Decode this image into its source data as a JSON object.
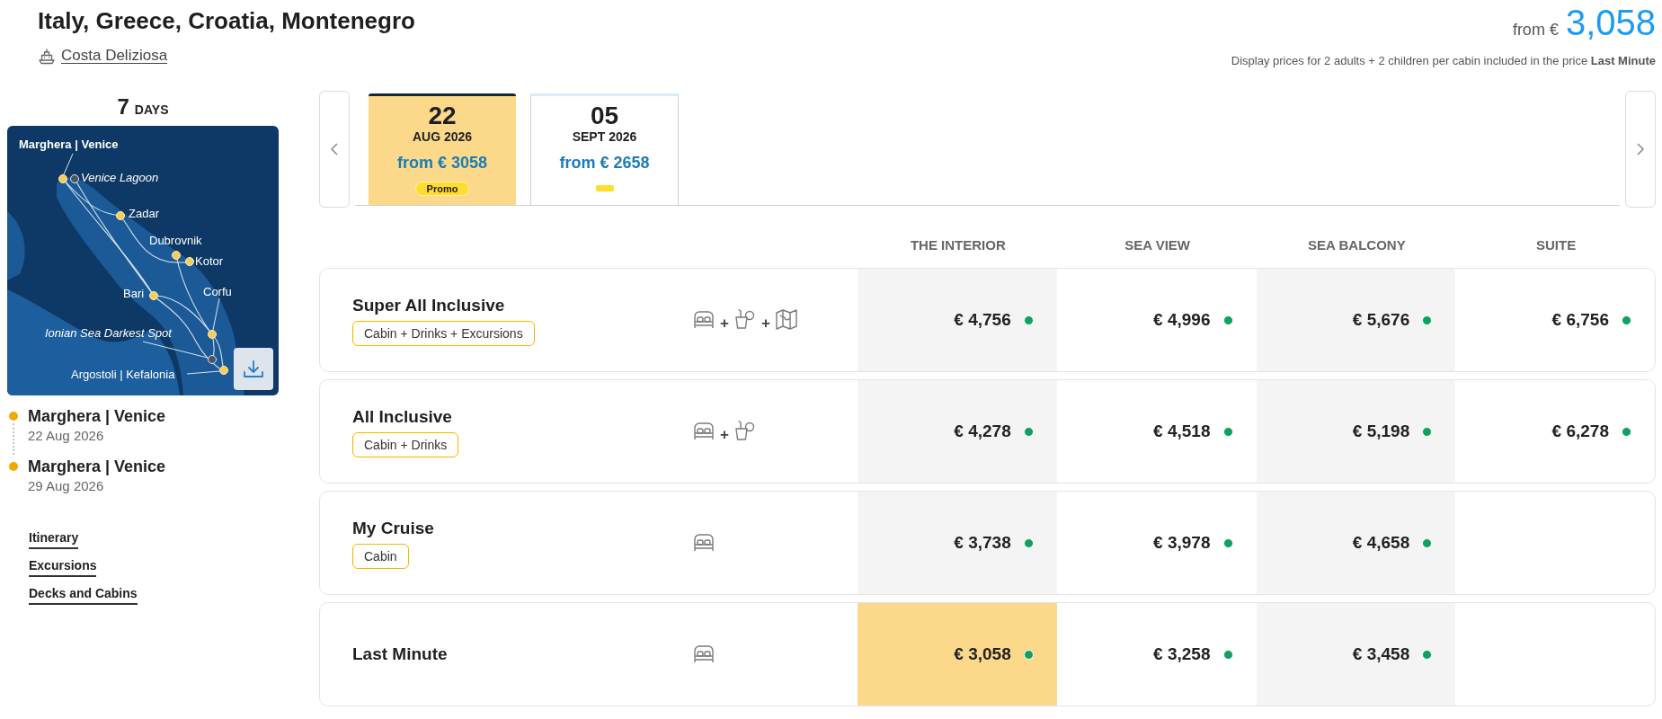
{
  "header": {
    "title": "Italy, Greece, Croatia, Montenegro",
    "ship": "Costa Deliziosa",
    "price_prefix": "from €",
    "price": "3,058",
    "note": "Display prices for 2 adults + 2 children per cabin included in the price **Last Minute**"
  },
  "sidebar": {
    "duration_number": "7",
    "duration_unit": "DAYS",
    "map_labels": [
      {
        "text": "Marghera | Venice",
        "kind": "home"
      },
      {
        "text": "Venice Lagoon",
        "kind": "scenic"
      },
      {
        "text": "Zadar",
        "kind": "port"
      },
      {
        "text": "Dubrovnik",
        "kind": "port"
      },
      {
        "text": "Kotor",
        "kind": "port"
      },
      {
        "text": "Bari",
        "kind": "port"
      },
      {
        "text": "Corfu",
        "kind": "port"
      },
      {
        "text": "Ionian Sea Darkest Spot",
        "kind": "scenic"
      },
      {
        "text": "Argostoli | Kefalonia",
        "kind": "port"
      }
    ],
    "ports": [
      {
        "name": "Marghera | Venice",
        "date": "22 Aug 2026"
      },
      {
        "name": "Marghera | Venice",
        "date": "29 Aug 2026"
      }
    ],
    "links": [
      "Itinerary",
      "Excursions",
      "Decks and Cabins"
    ]
  },
  "date_tabs": [
    {
      "day": "22",
      "month": "AUG 2026",
      "price": "from € 3058",
      "badge": "Promo",
      "selected": true
    },
    {
      "day": "05",
      "month": "SEPT 2026",
      "price": "from € 2658",
      "selected": false
    }
  ],
  "fare_table": {
    "columns": [
      "THE INTERIOR",
      "SEA VIEW",
      "SEA BALCONY",
      "SUITE"
    ],
    "rows": [
      {
        "name": "Super All Inclusive",
        "tag": "Cabin + Drinks + Excursions",
        "services": [
          {
            "kind": "cabin"
          },
          {
            "kind": "drinks",
            "joiner": "+"
          },
          {
            "kind": "excursions",
            "joiner": "+"
          }
        ],
        "prices": [
          {
            "price": "€ 4,756",
            "selected": false
          },
          {
            "price": "€ 4,996",
            "selected": false
          },
          {
            "price": "€ 5,676",
            "selected": false
          },
          {
            "price": "€ 6,756",
            "selected": false
          }
        ]
      },
      {
        "name": "All Inclusive",
        "tag": "Cabin + Drinks",
        "services": [
          {
            "kind": "cabin"
          },
          {
            "kind": "drinks",
            "joiner": "+"
          }
        ],
        "prices": [
          {
            "price": "€ 4,278",
            "selected": false
          },
          {
            "price": "€ 4,518",
            "selected": false
          },
          {
            "price": "€ 5,198",
            "selected": false
          },
          {
            "price": "€ 6,278",
            "selected": false
          }
        ]
      },
      {
        "name": "My Cruise",
        "tag": "Cabin",
        "services": [
          {
            "kind": "cabin"
          }
        ],
        "prices": [
          {
            "price": "€ 3,738",
            "selected": false
          },
          {
            "price": "€ 3,978",
            "selected": false
          },
          {
            "price": "€ 4,658",
            "selected": false
          }
        ]
      },
      {
        "name": "Last Minute",
        "services": [
          {
            "kind": "cabin"
          }
        ],
        "prices": [
          {
            "price": "€ 3,058",
            "selected": true
          },
          {
            "price": "€ 3,258",
            "selected": false
          },
          {
            "price": "€ 3,458",
            "selected": false
          }
        ]
      }
    ]
  }
}
